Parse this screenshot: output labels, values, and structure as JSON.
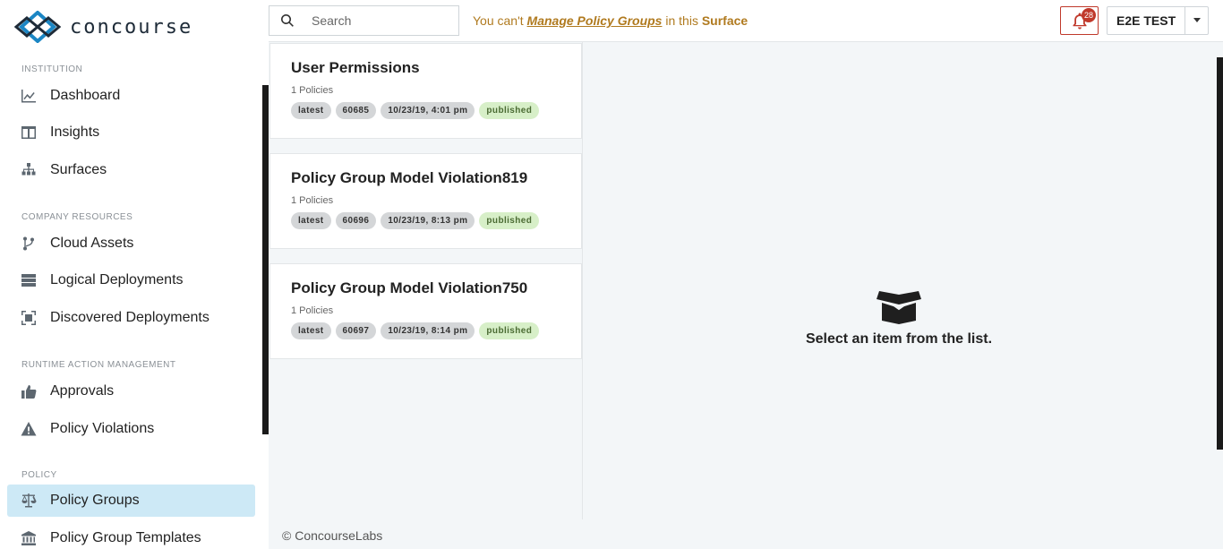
{
  "app": {
    "brand": "concourse"
  },
  "sidebar": {
    "sections": [
      {
        "title": "INSTITUTION"
      },
      {
        "title": "COMPANY RESOURCES"
      },
      {
        "title": "RUNTIME ACTION MANAGEMENT"
      },
      {
        "title": "POLICY"
      }
    ],
    "items": [
      {
        "label": "Dashboard",
        "icon": "chart-line-icon"
      },
      {
        "label": "Insights",
        "icon": "columns-icon"
      },
      {
        "label": "Surfaces",
        "icon": "sitemap-icon"
      },
      {
        "label": "Cloud Assets",
        "icon": "branch-icon"
      },
      {
        "label": "Logical Deployments",
        "icon": "server-icon"
      },
      {
        "label": "Discovered Deployments",
        "icon": "scan-icon"
      },
      {
        "label": "Approvals",
        "icon": "thumbs-up-icon"
      },
      {
        "label": "Policy Violations",
        "icon": "warning-icon"
      },
      {
        "label": "Policy Groups",
        "icon": "balance-scale-icon",
        "active": true
      },
      {
        "label": "Policy Group Templates",
        "icon": "bank-icon"
      }
    ]
  },
  "topbar": {
    "search_placeholder": "Search",
    "notice_prefix": "You can't ",
    "notice_action": "Manage Policy Groups",
    "notice_middle": " in this ",
    "notice_target": "Surface",
    "notification_count": "28",
    "user_name": "E2E TEST"
  },
  "list": {
    "cards": [
      {
        "title": "User Permissions",
        "subtitle": "1 Policies",
        "tags": [
          "latest",
          "60685",
          "10/23/19, 4:01 pm",
          "published"
        ]
      },
      {
        "title": "Policy Group Model Violation819",
        "subtitle": "1 Policies",
        "tags": [
          "latest",
          "60696",
          "10/23/19, 8:13 pm",
          "published"
        ]
      },
      {
        "title": "Policy Group Model Violation750",
        "subtitle": "1 Policies",
        "tags": [
          "latest",
          "60697",
          "10/23/19, 8:14 pm",
          "published"
        ]
      }
    ]
  },
  "detail": {
    "empty_text": "Select an item from the list."
  },
  "footer": {
    "text": "© ConcourseLabs"
  },
  "colors": {
    "accent": "#c0392b",
    "active_bg": "#cde9f6",
    "notice": "#b07a1f",
    "published_bg": "#d7efc8"
  }
}
